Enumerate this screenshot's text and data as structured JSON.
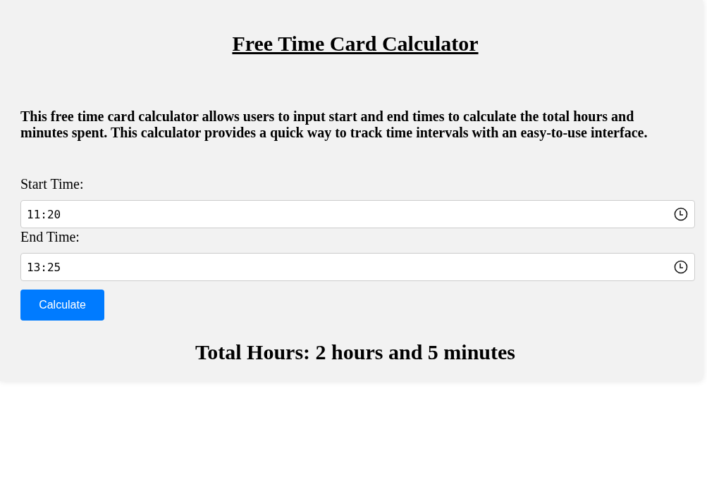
{
  "title": "Free Time Card Calculator",
  "description": "This free time card calculator allows users to input start and end times to calculate the total hours and minutes spent. This calculator provides a quick way to track time intervals with an easy-to-use interface.",
  "fields": [
    {
      "label": "Start Time:",
      "value": "11:20"
    },
    {
      "label": "End Time:",
      "value": "13:25"
    }
  ],
  "button": "Calculate",
  "result": "Total Hours: 2 hours and 5 minutes"
}
